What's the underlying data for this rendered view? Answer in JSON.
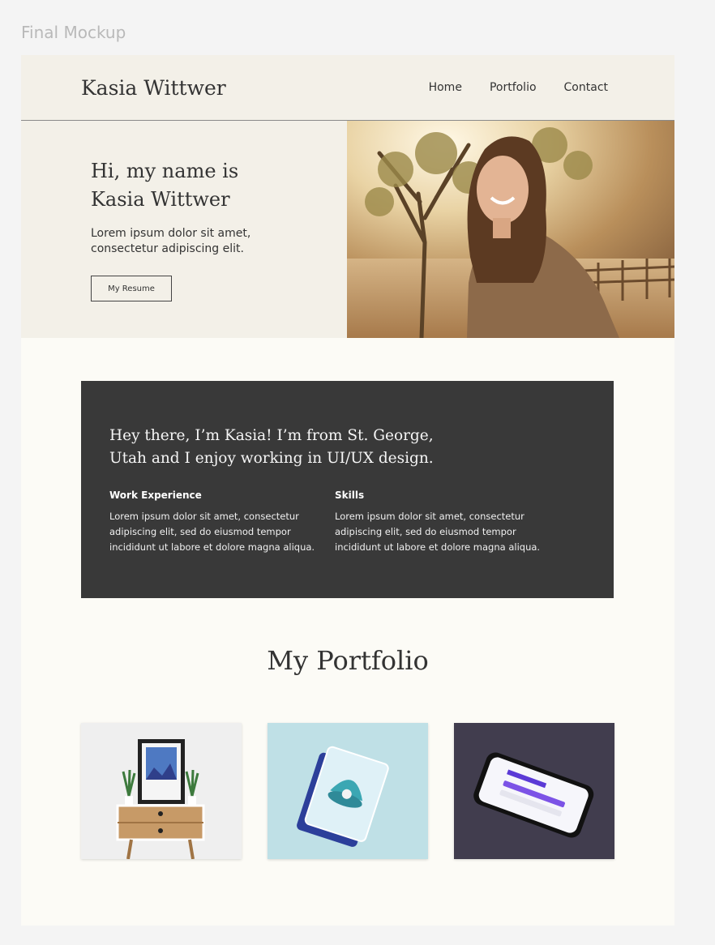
{
  "frame_label": "Final Mockup",
  "header": {
    "brand": "Kasia Wittwer",
    "nav": [
      "Home",
      "Portfolio",
      "Contact"
    ]
  },
  "hero": {
    "title_line1": "Hi, my name is",
    "title_line2": "Kasia Wittwer",
    "text": "Lorem ipsum dolor sit amet, consectetur adipiscing elit.",
    "button": "My Resume"
  },
  "about": {
    "title": "Hey there, I’m Kasia! I’m from St. George, Utah and I enjoy working in UI/UX design.",
    "columns": [
      {
        "heading": "Work Experience",
        "text": "Lorem ipsum dolor sit amet, consectetur adipiscing elit, sed do eiusmod tempor incididunt ut labore et dolore magna aliqua."
      },
      {
        "heading": "Skills",
        "text": "Lorem ipsum dolor sit amet, consectetur adipiscing elit, sed do eiusmod tempor incididunt ut labore et dolore magna aliqua."
      }
    ]
  },
  "portfolio": {
    "title": "My Portfolio"
  },
  "colors": {
    "header_bg": "#f3f0e8",
    "page_bg": "#fcfbf6",
    "about_bg": "#393939",
    "text": "#333333"
  }
}
